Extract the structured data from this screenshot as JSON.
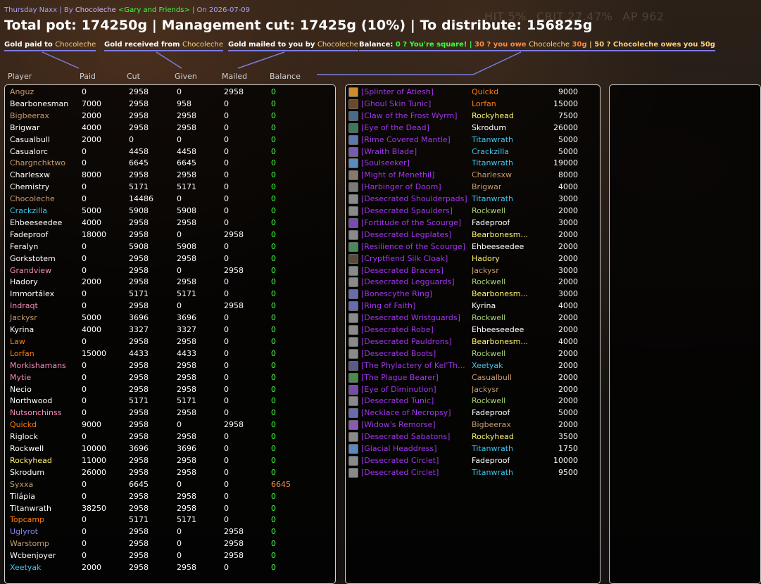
{
  "subtitle": {
    "raid": "Thursday Naxx",
    "by": "| By",
    "author": "Chocoleche",
    "guild": "<Gary and Friends>",
    "date": "| On 2026-07-09"
  },
  "ghost_stats": [
    "HIT 5%",
    "CRIT 27.47%",
    "AP 962"
  ],
  "summary": "Total pot: 174250g | Management cut: 17425g (10%) | To distribute: 156825g",
  "legend": {
    "paid": {
      "text": "Gold paid to",
      "name": "Chocoleche"
    },
    "received": {
      "text": "Gold received from",
      "name": "Chocoleche"
    },
    "mailed": {
      "text": "Gold mailed to you by",
      "name": "Chocoleche"
    },
    "balance": {
      "label": "Balance:",
      "square": "0 ? You're square!",
      "sep1": "|",
      "owe_prefix": "30 ? you owe",
      "owe_name": "Chocoleche",
      "owe_amount": "30g",
      "sep2": "|",
      "owes_prefix": "50 ? Chocoleche owes you 50g"
    }
  },
  "columns": [
    "Player",
    "Paid",
    "Cut",
    "Given",
    "Mailed",
    "Balance"
  ],
  "colors": {
    "balance_zero": "#40ff40",
    "balance_owed": "#ff8a3d",
    "epic_item": "#a335ee",
    "legend_underline": "#7d7de0"
  },
  "players": [
    {
      "name": "Anguz",
      "cls": "warrior",
      "paid": "0",
      "cut": "2958",
      "given": "0",
      "mailed": "2958",
      "balance": "0"
    },
    {
      "name": "Bearbonesman",
      "cls": "priest",
      "paid": "7000",
      "cut": "2958",
      "given": "958",
      "mailed": "0",
      "balance": "0"
    },
    {
      "name": "Bigbeerax",
      "cls": "warrior",
      "paid": "2000",
      "cut": "2958",
      "given": "2958",
      "mailed": "0",
      "balance": "0"
    },
    {
      "name": "Brigwar",
      "cls": "priest",
      "paid": "4000",
      "cut": "2958",
      "given": "2958",
      "mailed": "0",
      "balance": "0"
    },
    {
      "name": "Casualbull",
      "cls": "priest",
      "paid": "2000",
      "cut": "0",
      "given": "0",
      "mailed": "0",
      "balance": "0"
    },
    {
      "name": "Casualorc",
      "cls": "priest",
      "paid": "0",
      "cut": "4458",
      "given": "4458",
      "mailed": "0",
      "balance": "0"
    },
    {
      "name": "Chargnchktwo",
      "cls": "warrior",
      "paid": "0",
      "cut": "6645",
      "given": "6645",
      "mailed": "0",
      "balance": "0"
    },
    {
      "name": "Charlesxw",
      "cls": "priest",
      "paid": "8000",
      "cut": "2958",
      "given": "2958",
      "mailed": "0",
      "balance": "0"
    },
    {
      "name": "Chemistry",
      "cls": "priest",
      "paid": "0",
      "cut": "5171",
      "given": "5171",
      "mailed": "0",
      "balance": "0"
    },
    {
      "name": "Chocoleche",
      "cls": "warrior",
      "paid": "0",
      "cut": "14486",
      "given": "0",
      "mailed": "0",
      "balance": "0"
    },
    {
      "name": "Crackzilla",
      "cls": "mage",
      "paid": "5000",
      "cut": "5908",
      "given": "5908",
      "mailed": "0",
      "balance": "0"
    },
    {
      "name": "Ehbeeseedee",
      "cls": "priest",
      "paid": "4000",
      "cut": "2958",
      "given": "2958",
      "mailed": "0",
      "balance": "0"
    },
    {
      "name": "Fadeproof",
      "cls": "priest",
      "paid": "18000",
      "cut": "2958",
      "given": "0",
      "mailed": "2958",
      "balance": "0"
    },
    {
      "name": "Feralyn",
      "cls": "priest",
      "paid": "0",
      "cut": "5908",
      "given": "5908",
      "mailed": "0",
      "balance": "0"
    },
    {
      "name": "Gorkstotem",
      "cls": "priest",
      "paid": "0",
      "cut": "2958",
      "given": "2958",
      "mailed": "0",
      "balance": "0"
    },
    {
      "name": "Grandview",
      "cls": "paladin",
      "paid": "0",
      "cut": "2958",
      "given": "0",
      "mailed": "2958",
      "balance": "0"
    },
    {
      "name": "Hadory",
      "cls": "priest",
      "paid": "2000",
      "cut": "2958",
      "given": "2958",
      "mailed": "0",
      "balance": "0"
    },
    {
      "name": "Immortálex",
      "cls": "priest",
      "paid": "0",
      "cut": "5171",
      "given": "5171",
      "mailed": "0",
      "balance": "0"
    },
    {
      "name": "Indraqt",
      "cls": "paladin",
      "paid": "0",
      "cut": "2958",
      "given": "0",
      "mailed": "2958",
      "balance": "0"
    },
    {
      "name": "Jackysr",
      "cls": "warrior",
      "paid": "5000",
      "cut": "3696",
      "given": "3696",
      "mailed": "0",
      "balance": "0"
    },
    {
      "name": "Kyrina",
      "cls": "priest",
      "paid": "4000",
      "cut": "3327",
      "given": "3327",
      "mailed": "0",
      "balance": "0"
    },
    {
      "name": "Law",
      "cls": "druid",
      "paid": "0",
      "cut": "2958",
      "given": "2958",
      "mailed": "0",
      "balance": "0"
    },
    {
      "name": "Lorfan",
      "cls": "druid",
      "paid": "15000",
      "cut": "4433",
      "given": "4433",
      "mailed": "0",
      "balance": "0"
    },
    {
      "name": "Morkishamans",
      "cls": "paladin",
      "paid": "0",
      "cut": "2958",
      "given": "2958",
      "mailed": "0",
      "balance": "0"
    },
    {
      "name": "Mytie",
      "cls": "paladin",
      "paid": "0",
      "cut": "2958",
      "given": "2958",
      "mailed": "0",
      "balance": "0"
    },
    {
      "name": "Necio",
      "cls": "priest",
      "paid": "0",
      "cut": "2958",
      "given": "2958",
      "mailed": "0",
      "balance": "0"
    },
    {
      "name": "Northwood",
      "cls": "priest",
      "paid": "0",
      "cut": "5171",
      "given": "5171",
      "mailed": "0",
      "balance": "0"
    },
    {
      "name": "Nutsonchinss",
      "cls": "paladin",
      "paid": "0",
      "cut": "2958",
      "given": "2958",
      "mailed": "0",
      "balance": "0"
    },
    {
      "name": "Quickd",
      "cls": "druid",
      "paid": "9000",
      "cut": "2958",
      "given": "0",
      "mailed": "2958",
      "balance": "0"
    },
    {
      "name": "Riglock",
      "cls": "priest",
      "paid": "0",
      "cut": "2958",
      "given": "2958",
      "mailed": "0",
      "balance": "0"
    },
    {
      "name": "Rockwell",
      "cls": "priest",
      "paid": "10000",
      "cut": "3696",
      "given": "3696",
      "mailed": "0",
      "balance": "0"
    },
    {
      "name": "Rockyhead",
      "cls": "rogue",
      "paid": "11000",
      "cut": "2958",
      "given": "2958",
      "mailed": "0",
      "balance": "0"
    },
    {
      "name": "Skrodum",
      "cls": "priest",
      "paid": "26000",
      "cut": "2958",
      "given": "2958",
      "mailed": "0",
      "balance": "0"
    },
    {
      "name": "Syxxa",
      "cls": "warrior",
      "paid": "0",
      "cut": "6645",
      "given": "0",
      "mailed": "0",
      "balance": "6645"
    },
    {
      "name": "Tilápia",
      "cls": "priest",
      "paid": "0",
      "cut": "2958",
      "given": "2958",
      "mailed": "0",
      "balance": "0"
    },
    {
      "name": "Titanwrath",
      "cls": "priest",
      "paid": "38250",
      "cut": "2958",
      "given": "2958",
      "mailed": "0",
      "balance": "0"
    },
    {
      "name": "Topcamp",
      "cls": "druid",
      "paid": "0",
      "cut": "5171",
      "given": "5171",
      "mailed": "0",
      "balance": "0"
    },
    {
      "name": "Uglyrot",
      "cls": "warlock",
      "paid": "0",
      "cut": "2958",
      "given": "0",
      "mailed": "2958",
      "balance": "0"
    },
    {
      "name": "Warstomp",
      "cls": "warrior",
      "paid": "0",
      "cut": "2958",
      "given": "0",
      "mailed": "2958",
      "balance": "0"
    },
    {
      "name": "Wcbenjoyer",
      "cls": "priest",
      "paid": "0",
      "cut": "2958",
      "given": "0",
      "mailed": "2958",
      "balance": "0"
    },
    {
      "name": "Xeetyak",
      "cls": "mage",
      "paid": "2000",
      "cut": "2958",
      "given": "2958",
      "mailed": "0",
      "balance": "0"
    }
  ],
  "loot": [
    {
      "item": "[Splinter of Atiesh]",
      "winner": "Quickd",
      "wcls": "druid",
      "price": "9000",
      "icon": "#d08b2a"
    },
    {
      "item": "[Ghoul Skin Tunic]",
      "winner": "Lorfan",
      "wcls": "druid",
      "price": "15000",
      "icon": "#6a4a2a"
    },
    {
      "item": "[Claw of the Frost Wyrm]",
      "winner": "Rockyhead",
      "wcls": "rogue",
      "price": "7500",
      "icon": "#4a6a8a"
    },
    {
      "item": "[Eye of the Dead]",
      "winner": "Skrodum",
      "wcls": "priest",
      "price": "26000",
      "icon": "#3a7a5a"
    },
    {
      "item": "[Rime Covered Mantle]",
      "winner": "Titanwrath",
      "wcls": "mage",
      "price": "5000",
      "icon": "#5a7ab0"
    },
    {
      "item": "[Wraith Blade]",
      "winner": "Crackzilla",
      "wcls": "mage",
      "price": "5000",
      "icon": "#7a5ab0"
    },
    {
      "item": "[Soulseeker]",
      "winner": "Titanwrath",
      "wcls": "mage",
      "price": "19000",
      "icon": "#5a8ac0"
    },
    {
      "item": "[Might of Menethil]",
      "winner": "Charlesxw",
      "wcls": "warrior",
      "price": "8000",
      "icon": "#8a7a6a"
    },
    {
      "item": "[Harbinger of Doom]",
      "winner": "Brigwar",
      "wcls": "warrior",
      "price": "4000",
      "icon": "#7a7a7a"
    },
    {
      "item": "[Desecrated Shoulderpads]",
      "winner": "Titanwrath",
      "wcls": "mage",
      "price": "3000",
      "icon": "#8a8a8a"
    },
    {
      "item": "[Desecrated Spaulders]",
      "winner": "Rockwell",
      "wcls": "hunter",
      "price": "2000",
      "icon": "#8a8a8a"
    },
    {
      "item": "[Fortitude of the Scourge]",
      "winner": "Fadeproof",
      "wcls": "priest",
      "price": "3000",
      "icon": "#7a4ab0"
    },
    {
      "item": "[Desecrated Legplates]",
      "winner": "Bearbonesm...",
      "wcls": "rogue",
      "price": "2000",
      "icon": "#8a8a8a"
    },
    {
      "item": "[Resilience of the Scourge]",
      "winner": "Ehbeeseedee",
      "wcls": "priest",
      "price": "2000",
      "icon": "#4a8a5a"
    },
    {
      "item": "[Cryptfiend Silk Cloak]",
      "winner": "Hadory",
      "wcls": "rogue",
      "price": "2000",
      "icon": "#5a4a3a"
    },
    {
      "item": "[Desecrated Bracers]",
      "winner": "Jackysr",
      "wcls": "warrior",
      "price": "3000",
      "icon": "#8a8a8a"
    },
    {
      "item": "[Desecrated Legguards]",
      "winner": "Rockwell",
      "wcls": "hunter",
      "price": "2000",
      "icon": "#8a8a8a"
    },
    {
      "item": "[Bonescythe Ring]",
      "winner": "Bearbonesm...",
      "wcls": "rogue",
      "price": "3000",
      "icon": "#6a6ab0"
    },
    {
      "item": "[Ring of Faith]",
      "winner": "Kyrina",
      "wcls": "priest",
      "price": "4000",
      "icon": "#6a6ab0"
    },
    {
      "item": "[Desecrated Wristguards]",
      "winner": "Rockwell",
      "wcls": "hunter",
      "price": "2000",
      "icon": "#8a8a8a"
    },
    {
      "item": "[Desecrated Robe]",
      "winner": "Ehbeeseedee",
      "wcls": "priest",
      "price": "2000",
      "icon": "#8a8a8a"
    },
    {
      "item": "[Desecrated Pauldrons]",
      "winner": "Bearbonesm...",
      "wcls": "rogue",
      "price": "4000",
      "icon": "#8a8a8a"
    },
    {
      "item": "[Desecrated Boots]",
      "winner": "Rockwell",
      "wcls": "hunter",
      "price": "2000",
      "icon": "#8a8a8a"
    },
    {
      "item": "[The Phylactery of Kel'Th...",
      "winner": "Xeetyak",
      "wcls": "mage",
      "price": "2000",
      "icon": "#5a5a8a"
    },
    {
      "item": "[The Plague Bearer]",
      "winner": "Casualbull",
      "wcls": "warrior",
      "price": "2000",
      "icon": "#4a8a4a"
    },
    {
      "item": "[Eye of Diminution]",
      "winner": "Jackysr",
      "wcls": "warrior",
      "price": "2000",
      "icon": "#7a4ab0"
    },
    {
      "item": "[Desecrated Tunic]",
      "winner": "Rockwell",
      "wcls": "hunter",
      "price": "2000",
      "icon": "#8a8a8a"
    },
    {
      "item": "[Necklace of Necropsy]",
      "winner": "Fadeproof",
      "wcls": "priest",
      "price": "5000",
      "icon": "#6a6ab0"
    },
    {
      "item": "[Widow's Remorse]",
      "winner": "Bigbeerax",
      "wcls": "warrior",
      "price": "2000",
      "icon": "#8a5ab0"
    },
    {
      "item": "[Desecrated Sabatons]",
      "winner": "Rockyhead",
      "wcls": "rogue",
      "price": "3500",
      "icon": "#8a8a8a"
    },
    {
      "item": "[Glacial Headdress]",
      "winner": "Titanwrath",
      "wcls": "mage",
      "price": "1750",
      "icon": "#5a8ac0"
    },
    {
      "item": "[Desecrated Circlet]",
      "winner": "Fadeproof",
      "wcls": "priest",
      "price": "10000",
      "icon": "#8a8a8a"
    },
    {
      "item": "[Desecrated Circlet]",
      "winner": "Titanwrath",
      "wcls": "mage",
      "price": "9500",
      "icon": "#8a8a8a"
    }
  ]
}
